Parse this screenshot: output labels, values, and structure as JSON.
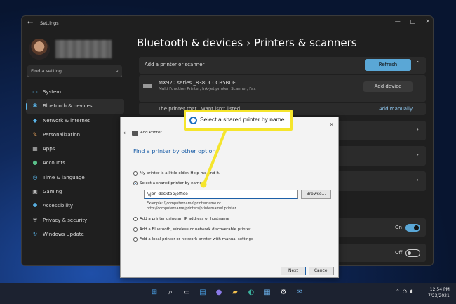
{
  "window": {
    "title": "Settings",
    "controls": [
      "—",
      "□",
      "✕"
    ]
  },
  "search": {
    "placeholder": "Find a setting"
  },
  "sidebar": {
    "items": [
      {
        "label": "System",
        "icon": "▭"
      },
      {
        "label": "Bluetooth & devices",
        "icon": "✱"
      },
      {
        "label": "Network & internet",
        "icon": "◆"
      },
      {
        "label": "Personalization",
        "icon": "✎"
      },
      {
        "label": "Apps",
        "icon": "▦"
      },
      {
        "label": "Accounts",
        "icon": "●"
      },
      {
        "label": "Time & language",
        "icon": "◷"
      },
      {
        "label": "Gaming",
        "icon": "▣"
      },
      {
        "label": "Accessibility",
        "icon": "✚"
      },
      {
        "label": "Privacy & security",
        "icon": "⛨"
      },
      {
        "label": "Windows Update",
        "icon": "↻"
      }
    ],
    "active": "Bluetooth & devices"
  },
  "header": {
    "breadcrumb_parent": "Bluetooth & devices",
    "separator": "›",
    "title": "Printers & scanners"
  },
  "main": {
    "add_label": "Add a printer or scanner",
    "refresh_label": "Refresh",
    "printer": {
      "name": "MX920 series _838DCCCB5BDF",
      "desc": "Multi Function Printer, Ink-jet printer, Scanner, Fax"
    },
    "add_device_label": "Add device",
    "not_listed_label": "The printer that I want isn't listed",
    "add_manually_label": "Add manually",
    "toggle_on_label": "On",
    "toggle_off_label": "Off"
  },
  "dialog": {
    "title": "Add Printer",
    "heading": "Find a printer by other options",
    "options": [
      "My printer is a little older. Help me find it.",
      "Select a shared printer by name",
      "Add a printer using an IP address or hostname",
      "Add a Bluetooth, wireless or network discoverable printer",
      "Add a local printer or network printer with manual settings"
    ],
    "selected_option": "Select a shared printer by name",
    "share_value": "\\\\jon-desktop\\office",
    "browse_label": "Browse...",
    "example_line1": "Example: \\\\computername\\printername or",
    "example_line2": "http://computername/printers/printername/.printer",
    "next_label": "Next",
    "cancel_label": "Cancel"
  },
  "callout": {
    "text": "Select a shared printer by name",
    "border_color": "#f5e52c"
  },
  "taskbar": {
    "icons": [
      "windows-start",
      "search",
      "task-view",
      "widgets",
      "chat",
      "file-explorer",
      "edge",
      "store",
      "settings",
      "mail"
    ],
    "clock_time": "12:54 PM",
    "clock_date": "7/23/2021"
  },
  "colors": {
    "accent": "#5aa7d6",
    "dialog_heading": "#1c5fa8",
    "highlight": "#f5e52c"
  }
}
